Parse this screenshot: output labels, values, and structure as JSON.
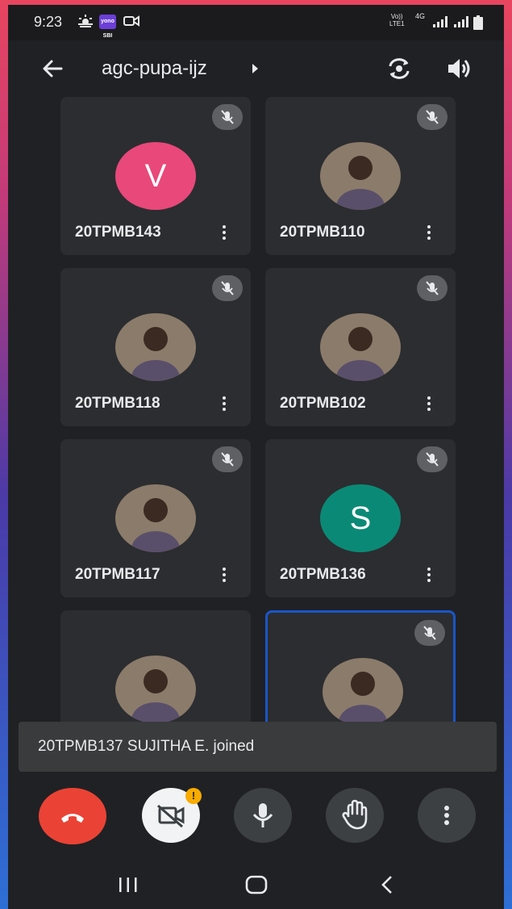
{
  "status_bar": {
    "time": "9:23",
    "yono_label": "yono SBI",
    "network_lines": [
      "Vo))",
      "LTE1"
    ],
    "network_type": "4G"
  },
  "header": {
    "meeting_code": "agc-pupa-ijz"
  },
  "participants": [
    {
      "name": "20TPMB143",
      "avatar_type": "letter",
      "initial": "V",
      "avatar_color": "#e8487a",
      "muted": true
    },
    {
      "name": "20TPMB110",
      "avatar_type": "photo",
      "avatar_icon": "person-photo-icon",
      "muted": true
    },
    {
      "name": "20TPMB118",
      "avatar_type": "photo",
      "avatar_icon": "person-photo-icon",
      "muted": true
    },
    {
      "name": "20TPMB102",
      "avatar_type": "photo",
      "avatar_icon": "person-photo-icon",
      "muted": true
    },
    {
      "name": "20TPMB117",
      "avatar_type": "photo",
      "avatar_icon": "person-photo-icon",
      "muted": true
    },
    {
      "name": "20TPMB136",
      "avatar_type": "letter",
      "initial": "S",
      "avatar_color": "#0a8a76",
      "muted": true
    },
    {
      "name": "",
      "avatar_type": "photo",
      "avatar_icon": "person-photo-icon",
      "muted": false
    },
    {
      "name": "",
      "avatar_type": "photo",
      "avatar_icon": "person-photo-icon",
      "muted": true,
      "is_self": true
    }
  ],
  "toast": {
    "message": "20TPMB137 SUJITHA E. joined"
  },
  "controls": {
    "camera_alert": "!"
  },
  "colors": {
    "end_call": "#ea4335",
    "self_border": "#1a56c8",
    "alert": "#f9ab00"
  }
}
